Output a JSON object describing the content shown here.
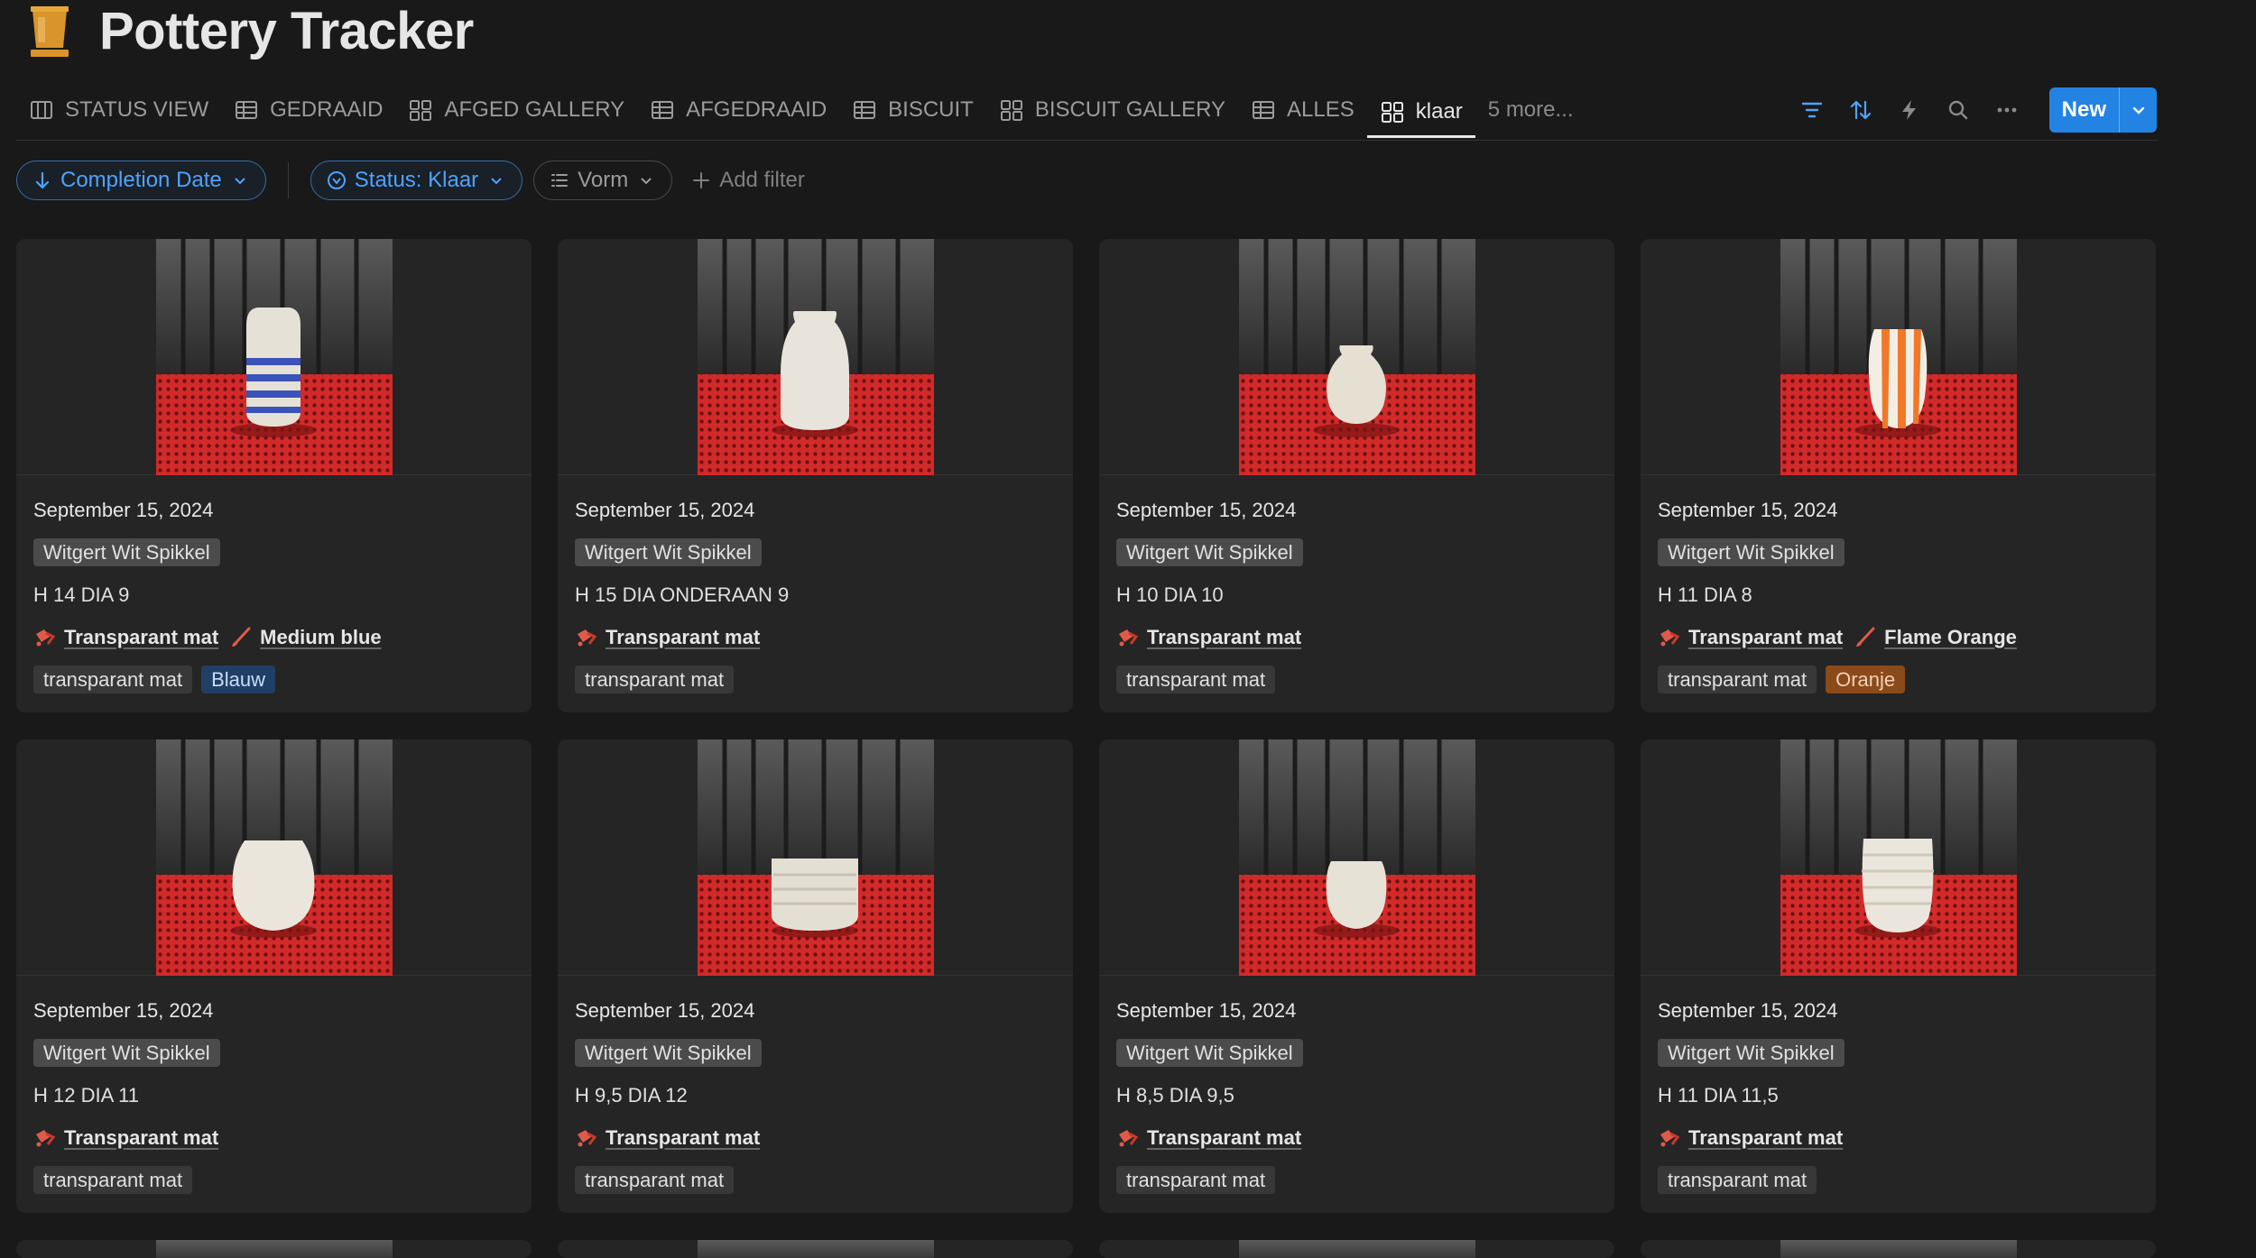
{
  "page": {
    "title": "Pottery Tracker",
    "icon": "beaker-icon"
  },
  "tabs": [
    {
      "label": "STATUS VIEW",
      "icon": "board-icon",
      "active": false
    },
    {
      "label": "GEDRAAID",
      "icon": "table-icon",
      "active": false
    },
    {
      "label": "AFGED GALLERY",
      "icon": "gallery-icon",
      "active": false
    },
    {
      "label": "AFGEDRAAID",
      "icon": "table-icon",
      "active": false
    },
    {
      "label": "BISCUIT",
      "icon": "table-icon",
      "active": false
    },
    {
      "label": "BISCUIT GALLERY",
      "icon": "gallery-icon",
      "active": false
    },
    {
      "label": "ALLES",
      "icon": "table-icon",
      "active": false
    },
    {
      "label": "klaar",
      "icon": "gallery-icon",
      "active": true
    }
  ],
  "more_tabs": "5 more...",
  "toolbar": {
    "new_label": "New"
  },
  "filters": {
    "sort": "Completion Date",
    "status": "Status: Klaar",
    "vorm": "Vorm",
    "add": "Add filter"
  },
  "colors": {
    "accent": "#2383e2",
    "background": "#191919",
    "card": "#252525"
  },
  "cards": [
    {
      "date": "September 15, 2024",
      "clay": "Witgert Wit Spikkel",
      "dims": "H 14 DIA 9",
      "glaze1": "Transparant mat",
      "glaze2": "Medium blue",
      "tag1": "transparant mat",
      "tag2": "Blauw",
      "tag2_color": "blue",
      "pot": "stripes-blue"
    },
    {
      "date": "September 15, 2024",
      "clay": "Witgert Wit Spikkel",
      "dims": "H 15 DIA ONDERAAN 9",
      "glaze1": "Transparant mat",
      "glaze2": "",
      "tag1": "transparant mat",
      "tag2": "",
      "tag2_color": "",
      "pot": "tall"
    },
    {
      "date": "September 15, 2024",
      "clay": "Witgert Wit Spikkel",
      "dims": "H 10 DIA 10",
      "glaze1": "Transparant mat",
      "glaze2": "",
      "tag1": "transparant mat",
      "tag2": "",
      "tag2_color": "",
      "pot": "round"
    },
    {
      "date": "September 15, 2024",
      "clay": "Witgert Wit Spikkel",
      "dims": "H 11 DIA 8",
      "glaze1": "Transparant mat",
      "glaze2": "Flame Orange",
      "tag1": "transparant mat",
      "tag2": "Oranje",
      "tag2_color": "orange",
      "pot": "stripes-orange"
    },
    {
      "date": "September 15, 2024",
      "clay": "Witgert Wit Spikkel",
      "dims": "H 12 DIA 11",
      "glaze1": "Transparant mat",
      "glaze2": "",
      "tag1": "transparant mat",
      "tag2": "",
      "tag2_color": "",
      "pot": "wide"
    },
    {
      "date": "September 15, 2024",
      "clay": "Witgert Wit Spikkel",
      "dims": "H 9,5 DIA 12",
      "glaze1": "Transparant mat",
      "glaze2": "",
      "tag1": "transparant mat",
      "tag2": "",
      "tag2_color": "",
      "pot": "ribbed"
    },
    {
      "date": "September 15, 2024",
      "clay": "Witgert Wit Spikkel",
      "dims": "H 8,5 DIA 9,5",
      "glaze1": "Transparant mat",
      "glaze2": "",
      "tag1": "transparant mat",
      "tag2": "",
      "tag2_color": "",
      "pot": "small"
    },
    {
      "date": "September 15, 2024",
      "clay": "Witgert Wit Spikkel",
      "dims": "H 11 DIA 11,5",
      "glaze1": "Transparant mat",
      "glaze2": "",
      "tag1": "transparant mat",
      "tag2": "",
      "tag2_color": "",
      "pot": "ribbed-tall"
    }
  ]
}
